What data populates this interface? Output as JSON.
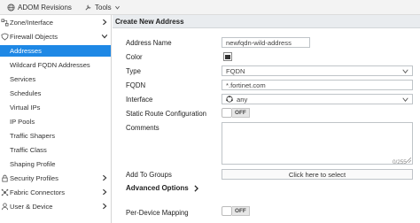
{
  "topbar": {
    "adom_label": "ADOM Revisions",
    "tools_label": "Tools"
  },
  "sidebar": {
    "items": [
      {
        "label": "Zone/Interface",
        "level": "top",
        "icon": "network-icon",
        "chevron": "right"
      },
      {
        "label": "Firewall Objects",
        "level": "top",
        "icon": "shield-icon",
        "chevron": "down"
      },
      {
        "label": "Addresses",
        "level": "sub",
        "active": true
      },
      {
        "label": "Wildcard FQDN Addresses",
        "level": "sub"
      },
      {
        "label": "Services",
        "level": "sub"
      },
      {
        "label": "Schedules",
        "level": "sub"
      },
      {
        "label": "Virtual IPs",
        "level": "sub"
      },
      {
        "label": "IP Pools",
        "level": "sub"
      },
      {
        "label": "Traffic Shapers",
        "level": "sub"
      },
      {
        "label": "Traffic Class",
        "level": "sub"
      },
      {
        "label": "Shaping Profile",
        "level": "sub"
      },
      {
        "label": "Security Profiles",
        "level": "top",
        "icon": "lock-icon",
        "chevron": "right"
      },
      {
        "label": "Fabric Connectors",
        "level": "top",
        "icon": "fabric-icon",
        "chevron": "right"
      },
      {
        "label": "User & Device",
        "level": "top",
        "icon": "user-icon",
        "chevron": "right"
      }
    ]
  },
  "panel": {
    "title": "Create New Address",
    "fields": {
      "address_name": {
        "label": "Address Name",
        "value": "newfqdn-wild-address"
      },
      "color": {
        "label": "Color"
      },
      "type": {
        "label": "Type",
        "value": "FQDN"
      },
      "fqdn": {
        "label": "FQDN",
        "value": "*.fortinet.com"
      },
      "interface": {
        "label": "Interface",
        "value": "any"
      },
      "static_route": {
        "label": "Static Route Configuration",
        "toggle": "OFF"
      },
      "comments": {
        "label": "Comments",
        "counter": "0/255"
      },
      "add_to_groups": {
        "label": "Add To Groups",
        "button": "Click here to select"
      },
      "advanced": {
        "label": "Advanced Options"
      },
      "per_device": {
        "label": "Per-Device Mapping",
        "toggle": "OFF"
      }
    }
  },
  "colors": {
    "accent": "#1e88e5",
    "header_bg": "#e9ecef",
    "topbar_bg": "#f3f3f3"
  }
}
